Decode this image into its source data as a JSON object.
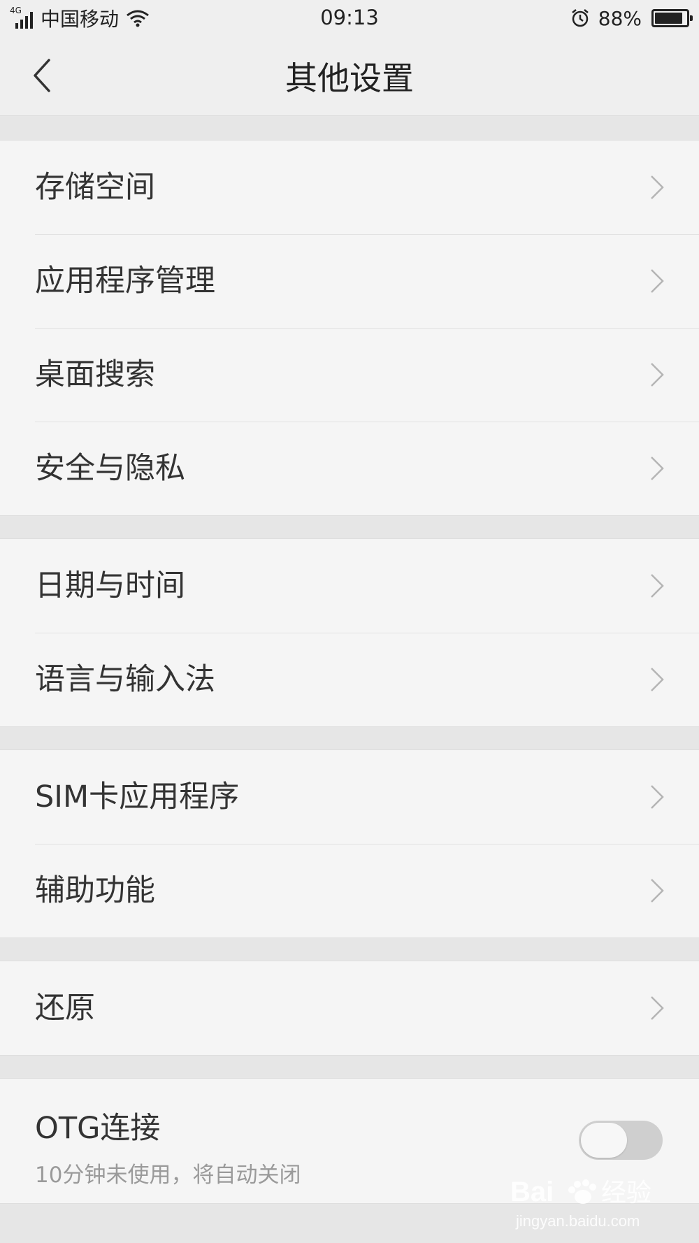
{
  "status_bar": {
    "network": "4G",
    "carrier": "中国移动",
    "time": "09:13",
    "battery_percent": "88%",
    "battery_level": 0.88
  },
  "header": {
    "title": "其他设置"
  },
  "groups": [
    {
      "items": [
        "存储空间",
        "应用程序管理",
        "桌面搜索",
        "安全与隐私"
      ]
    },
    {
      "items": [
        "日期与时间",
        "语言与输入法"
      ]
    },
    {
      "items": [
        "SIM卡应用程序",
        "辅助功能"
      ]
    },
    {
      "items": [
        "还原"
      ]
    }
  ],
  "otg": {
    "title": "OTG连接",
    "subtitle": "10分钟未使用，将自动关闭",
    "enabled": false
  },
  "watermark": {
    "brand": "Bai",
    "brand_suffix": "经验",
    "url": "jingyan.baidu.com"
  }
}
